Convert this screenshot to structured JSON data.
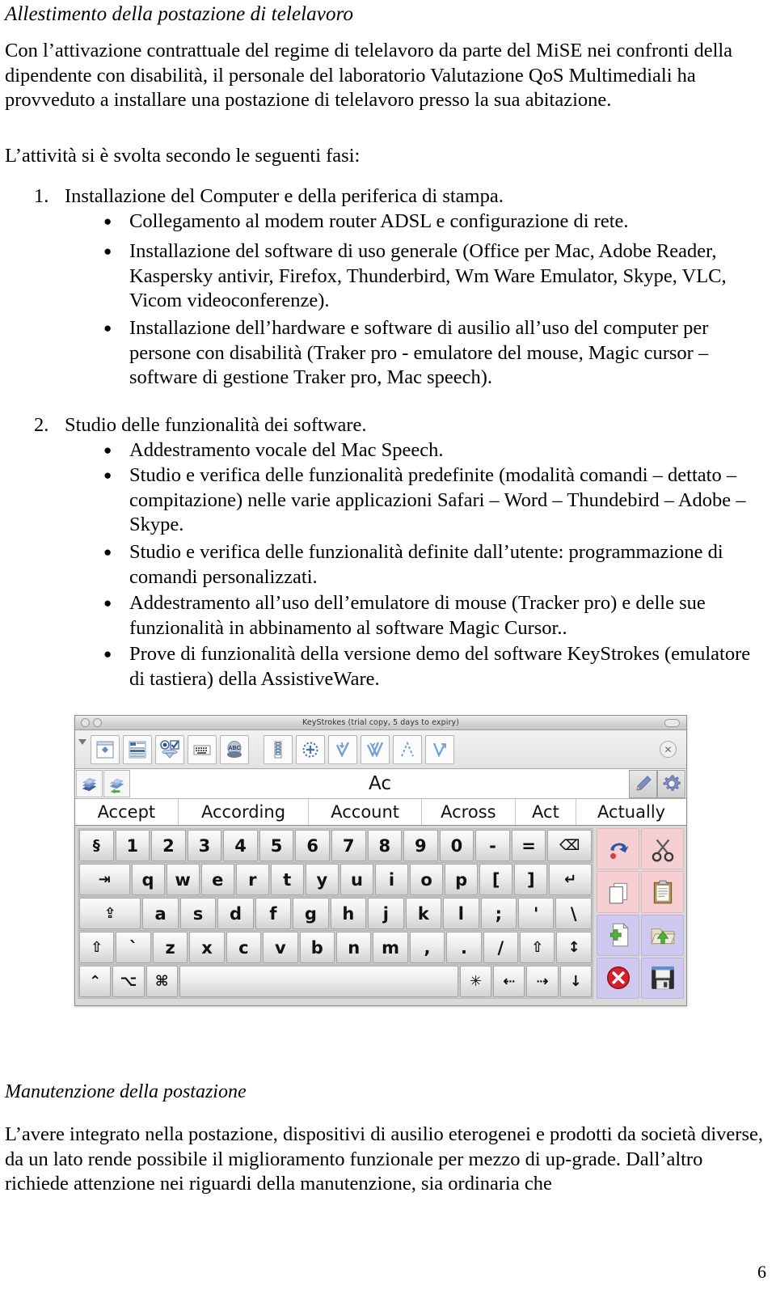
{
  "document": {
    "heading": "Allestimento della postazione di telelavoro",
    "intro_paragraph": "Con l’attivazione contrattuale del regime di telelavoro da parte del MiSE nei confronti della dipendente con disabilità, il personale del laboratorio Valutazione QoS Multimediali ha provveduto a installare una postazione di telelavoro presso la sua abitazione.",
    "fasi_lead": "L’attività si è svolta secondo le seguenti fasi:",
    "list": [
      {
        "number": "1.",
        "text": "Installazione del Computer e della periferica di stampa.",
        "bullets": [
          "Collegamento al modem router ADSL e configurazione di rete.",
          "Installazione del software di uso generale (Office per Mac, Adobe Reader, Kaspersky antivir, Firefox, Thunderbird, Wm Ware Emulator, Skype, VLC, Vicom videoconferenze).",
          "Installazione dell’hardware e software di ausilio all’uso del computer per persone con disabilità (Traker pro - emulatore del mouse, Magic cursor – software di gestione Traker pro, Mac speech)."
        ]
      },
      {
        "number": "2.",
        "text": "Studio delle funzionalità dei software.",
        "bullets": [
          "Addestramento vocale del Mac Speech.",
          "Studio e verifica delle funzionalità predefinite (modalità comandi – dettato – compitazione) nelle varie applicazioni Safari – Word – Thundebird – Adobe – Skype.",
          "Studio e verifica delle funzionalità definite dall’utente: programmazione di comandi personalizzati.",
          "Addestramento all’uso dell’emulatore di mouse (Tracker pro) e delle sue funzionalità in abbinamento al software Magic Cursor..",
          "Prove di funzionalità della versione demo del software KeyStrokes (emulatore di tastiera) della AssistiveWare."
        ]
      }
    ],
    "bullet_glyph": "●",
    "maintenance_heading": "Manutenzione della postazione",
    "maintenance_paragraph": "L’avere integrato nella postazione, dispositivi di ausilio eterogenei e prodotti da società diverse, da un lato rende possibile il miglioramento funzionale per mezzo di up-grade. Dall’altro richiede attenzione nei riguardi della manutenzione, sia ordinaria che",
    "page_number": "6"
  },
  "keystrokes": {
    "window_title": "KeyStrokes (trial copy, 5 days to expiry)",
    "current_word": "Ac",
    "predictions": [
      "Accept",
      "According",
      "Account",
      "Across",
      "Act",
      "Actually"
    ],
    "toolbar_icons": [
      "move-window-icon",
      "panel-layout-icon",
      "radio-check-options-icon",
      "keyboard-layout-icon",
      "speech-head-icon",
      "scan-strip-icon",
      "dwell-target-icon",
      "click-down-icon",
      "double-click-icon",
      "drag-path-icon",
      "drag-right-icon"
    ],
    "toolbar_close_icon": "close-x-icon",
    "wordbar_left_icons": [
      "dictionary-icon",
      "dictionary-add-icon"
    ],
    "wordbar_right_icons": [
      "pen-edit-icon",
      "gear-settings-icon"
    ],
    "titlebar_buttons": [
      "close-dot",
      "minimize-dot",
      "zoom-pill"
    ],
    "keyboard_rows": [
      {
        "name": "number-row",
        "keys": [
          {
            "label": "§",
            "name": "key-section"
          },
          {
            "label": "1",
            "name": "key-1"
          },
          {
            "label": "2",
            "name": "key-2"
          },
          {
            "label": "3",
            "name": "key-3"
          },
          {
            "label": "4",
            "name": "key-4"
          },
          {
            "label": "5",
            "name": "key-5"
          },
          {
            "label": "6",
            "name": "key-6"
          },
          {
            "label": "7",
            "name": "key-7"
          },
          {
            "label": "8",
            "name": "key-8"
          },
          {
            "label": "9",
            "name": "key-9"
          },
          {
            "label": "0",
            "name": "key-0"
          },
          {
            "label": "-",
            "name": "key-minus"
          },
          {
            "label": "=",
            "name": "key-equals"
          },
          {
            "label": "⌫",
            "name": "key-backspace",
            "width": "wide13"
          }
        ]
      },
      {
        "name": "top-letter-row",
        "keys": [
          {
            "label": "⇥",
            "name": "key-tab",
            "width": "wide15"
          },
          {
            "label": "q",
            "name": "key-q"
          },
          {
            "label": "w",
            "name": "key-w"
          },
          {
            "label": "e",
            "name": "key-e"
          },
          {
            "label": "r",
            "name": "key-r"
          },
          {
            "label": "t",
            "name": "key-t"
          },
          {
            "label": "y",
            "name": "key-y"
          },
          {
            "label": "u",
            "name": "key-u"
          },
          {
            "label": "i",
            "name": "key-i"
          },
          {
            "label": "o",
            "name": "key-o"
          },
          {
            "label": "p",
            "name": "key-p"
          },
          {
            "label": "[",
            "name": "key-bracket-left"
          },
          {
            "label": "]",
            "name": "key-bracket-right"
          },
          {
            "label": "↵",
            "name": "key-return",
            "width": "wide13"
          }
        ]
      },
      {
        "name": "home-letter-row",
        "keys": [
          {
            "label": "⇪",
            "name": "key-caps-lock",
            "width": "wide17"
          },
          {
            "label": "a",
            "name": "key-a"
          },
          {
            "label": "s",
            "name": "key-s"
          },
          {
            "label": "d",
            "name": "key-d"
          },
          {
            "label": "f",
            "name": "key-f"
          },
          {
            "label": "g",
            "name": "key-g"
          },
          {
            "label": "h",
            "name": "key-h"
          },
          {
            "label": "j",
            "name": "key-j"
          },
          {
            "label": "k",
            "name": "key-k"
          },
          {
            "label": "l",
            "name": "key-l"
          },
          {
            "label": ";",
            "name": "key-semicolon"
          },
          {
            "label": "'",
            "name": "key-quote"
          },
          {
            "label": "\\",
            "name": "key-backslash"
          }
        ]
      },
      {
        "name": "bottom-letter-row",
        "keys": [
          {
            "label": "⇧",
            "name": "key-shift-left"
          },
          {
            "label": "`",
            "name": "key-backtick"
          },
          {
            "label": "z",
            "name": "key-z"
          },
          {
            "label": "x",
            "name": "key-x"
          },
          {
            "label": "c",
            "name": "key-c"
          },
          {
            "label": "v",
            "name": "key-v"
          },
          {
            "label": "b",
            "name": "key-b"
          },
          {
            "label": "n",
            "name": "key-n"
          },
          {
            "label": "m",
            "name": "key-m"
          },
          {
            "label": ",",
            "name": "key-comma"
          },
          {
            "label": ".",
            "name": "key-period"
          },
          {
            "label": "/",
            "name": "key-slash"
          },
          {
            "label": "⇧",
            "name": "key-shift-right"
          },
          {
            "label": "↕",
            "name": "key-arrow-up-dotted"
          }
        ]
      },
      {
        "name": "modifier-row",
        "keys": [
          {
            "label": "⌃",
            "name": "key-control"
          },
          {
            "label": "⌥",
            "name": "key-option"
          },
          {
            "label": "⌘",
            "name": "key-command"
          },
          {
            "label": "",
            "name": "key-space",
            "width": "space"
          },
          {
            "label": "✳",
            "name": "key-star-modifier"
          },
          {
            "label": "⇠",
            "name": "key-arrow-left-dotted"
          },
          {
            "label": "⇢",
            "name": "key-arrow-right-dotted"
          },
          {
            "label": "↓",
            "name": "key-arrow-down-dotted"
          }
        ]
      }
    ],
    "side_buttons": [
      {
        "name": "undo-button",
        "icon": "undo-arrow-icon",
        "group": "edit"
      },
      {
        "name": "cut-button",
        "icon": "scissors-icon",
        "group": "edit"
      },
      {
        "name": "copy-button",
        "icon": "copy-pages-icon",
        "group": "edit"
      },
      {
        "name": "paste-button",
        "icon": "clipboard-icon",
        "group": "edit"
      },
      {
        "name": "new-file-button",
        "icon": "new-document-icon",
        "group": "file"
      },
      {
        "name": "open-file-button",
        "icon": "open-folder-icon",
        "group": "file"
      },
      {
        "name": "close-file-button",
        "icon": "close-red-x-icon",
        "group": "file"
      },
      {
        "name": "save-file-button",
        "icon": "floppy-disk-icon",
        "group": "file"
      }
    ]
  },
  "colors": {
    "edit_group": "#f6cfd2",
    "file_group": "#cfc9ef",
    "page_background": "#ffffff",
    "window_chrome": "#d8d8d8"
  }
}
